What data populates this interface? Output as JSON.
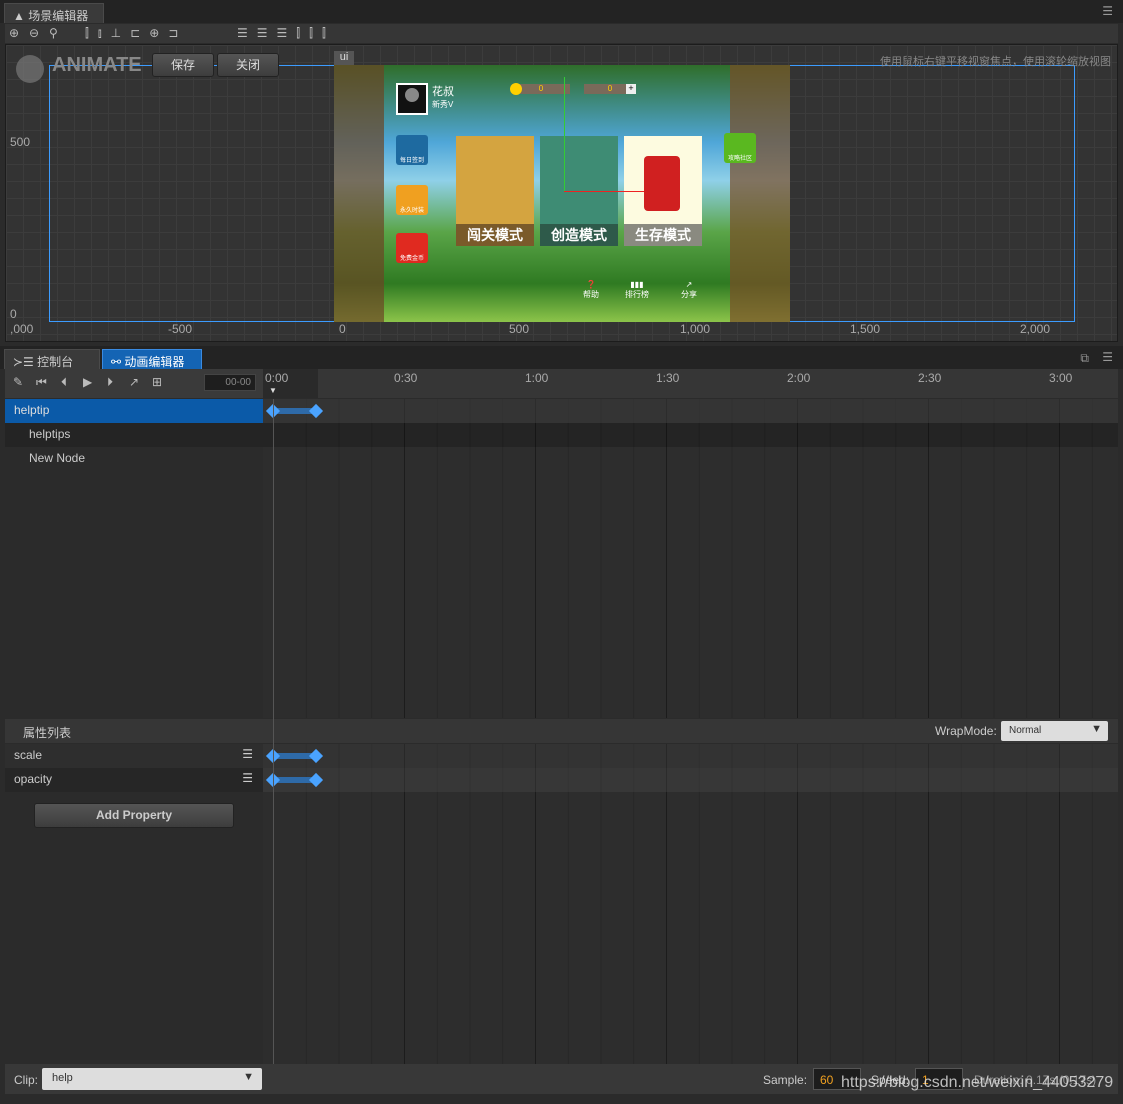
{
  "scene_editor": {
    "tab_title": "场景编辑器",
    "logo": "ANIMATE",
    "save_label": "保存",
    "close_label": "关闭",
    "node_tag": "ui",
    "hint": "使用鼠标右键平移视窗焦点，使用滚轮缩放视图",
    "y_labels": [
      "500",
      "0"
    ],
    "x_labels": [
      ",000",
      "-500",
      "0",
      "500",
      "1,000",
      "1,500",
      "2,000"
    ],
    "toolbar_icons": [
      "zoom-in-icon",
      "zoom-out-icon",
      "zoom-reset-icon",
      "align-top-icon",
      "align-vcenter-icon",
      "align-bottom-icon",
      "align-left-icon",
      "align-hcenter-icon",
      "align-right-icon",
      "distribute-top-icon",
      "distribute-vcenter-icon",
      "distribute-bottom-icon",
      "distribute-left-icon",
      "distribute-hcenter-icon",
      "distribute-right-icon"
    ],
    "game": {
      "player_name": "花叔",
      "player_level": "新秀V",
      "coins": "0",
      "hints": "0",
      "modes": [
        "闯关模式",
        "创造模式",
        "生存模式"
      ],
      "left_buttons": [
        "每日签到",
        "永久时装",
        "免费金币"
      ],
      "right_button": "攻略社区",
      "bottom_buttons": [
        "帮助",
        "排行榜",
        "分享"
      ]
    }
  },
  "bottom_tabs": [
    {
      "label": "控制台",
      "icon": "console-icon"
    },
    {
      "label": "动画编辑器",
      "icon": "animation-icon",
      "active": true
    }
  ],
  "anim": {
    "time_value": "00-00",
    "ticks": [
      "0:00",
      "0:30",
      "1:00",
      "1:30",
      "2:00",
      "2:30",
      "3:00"
    ],
    "nodes": [
      {
        "label": "helptip",
        "selected": true
      },
      {
        "label": "helptips"
      },
      {
        "label": "New Node"
      }
    ],
    "property_header": "属性列表",
    "wrapmode_label": "WrapMode:",
    "wrapmode_value": "Normal",
    "properties": [
      {
        "label": "scale"
      },
      {
        "label": "opacity"
      }
    ],
    "add_property": "Add Property",
    "clip_label": "Clip:",
    "clip_value": "help",
    "sample_label": "Sample:",
    "sample_value": "60",
    "speed_label": "Speed:",
    "speed_value": "1",
    "duration": "Duration: 0.17s (0.17s)"
  },
  "watermark": "https://blog.csdn.net/weixin_44053279",
  "colors": {
    "accent": "#1464b4",
    "keyframe": "#4aa3ff",
    "playhead": "#e02020"
  }
}
